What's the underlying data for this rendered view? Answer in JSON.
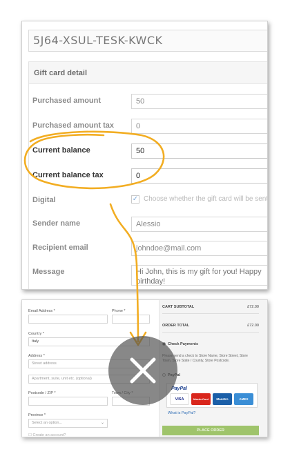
{
  "gift_card": {
    "code": "5J64-XSUL-TESK-KWCK",
    "section_title": "Gift card detail",
    "fields": {
      "purchased_amount": {
        "label": "Purchased amount",
        "value": "50"
      },
      "purchased_amount_tax": {
        "label": "Purchased amount tax",
        "value": "0"
      },
      "current_balance": {
        "label": "Current balance",
        "value": "50"
      },
      "current_balance_tax": {
        "label": "Current balance tax",
        "value": "0"
      },
      "digital": {
        "label": "Digital",
        "checkbox_text": "Choose whether the gift card will be sent via"
      },
      "sender_name": {
        "label": "Sender name",
        "value": "Alessio"
      },
      "recipient_email": {
        "label": "Recipient email",
        "value": "johndoe@mail.com"
      },
      "message": {
        "label": "Message",
        "value": "Hi John, this is my gift for you! Happy birthday!"
      }
    }
  },
  "checkout": {
    "billing": {
      "email_label": "Email Address *",
      "phone_label": "Phone *",
      "country_label": "Country *",
      "country_value": "Italy",
      "address_label": "Address *",
      "street_placeholder": "Street address",
      "apartment_placeholder": "Apartment, suite, unit etc. (optional)",
      "postcode_label": "Postcode / ZIP *",
      "town_label": "Town / City *",
      "province_label": "Province *",
      "province_placeholder": "Select an option...",
      "create_account_label": "Create an account?"
    },
    "summary": {
      "cart_subtotal_label": "CART SUBTOTAL",
      "cart_subtotal_value": "£72.00",
      "order_total_label": "ORDER TOTAL",
      "order_total_value": "£72.00"
    },
    "payment": {
      "check_payments_label": "Check Payments",
      "check_payments_desc": "Please send a check to Store Name, Store Street, Store Town, Store State / County, Store Postcode.",
      "paypal_label": "PayPal",
      "paypal_logo": "PayPal",
      "cards": [
        "VISA",
        "MasterCard",
        "Maestro",
        "AMEX"
      ],
      "what_is_paypal": "What is PayPal?",
      "place_order": "PLACE ORDER"
    }
  },
  "annotation": {
    "highlight_color": "#f2ad22",
    "close_icon": "close-x-icon"
  }
}
